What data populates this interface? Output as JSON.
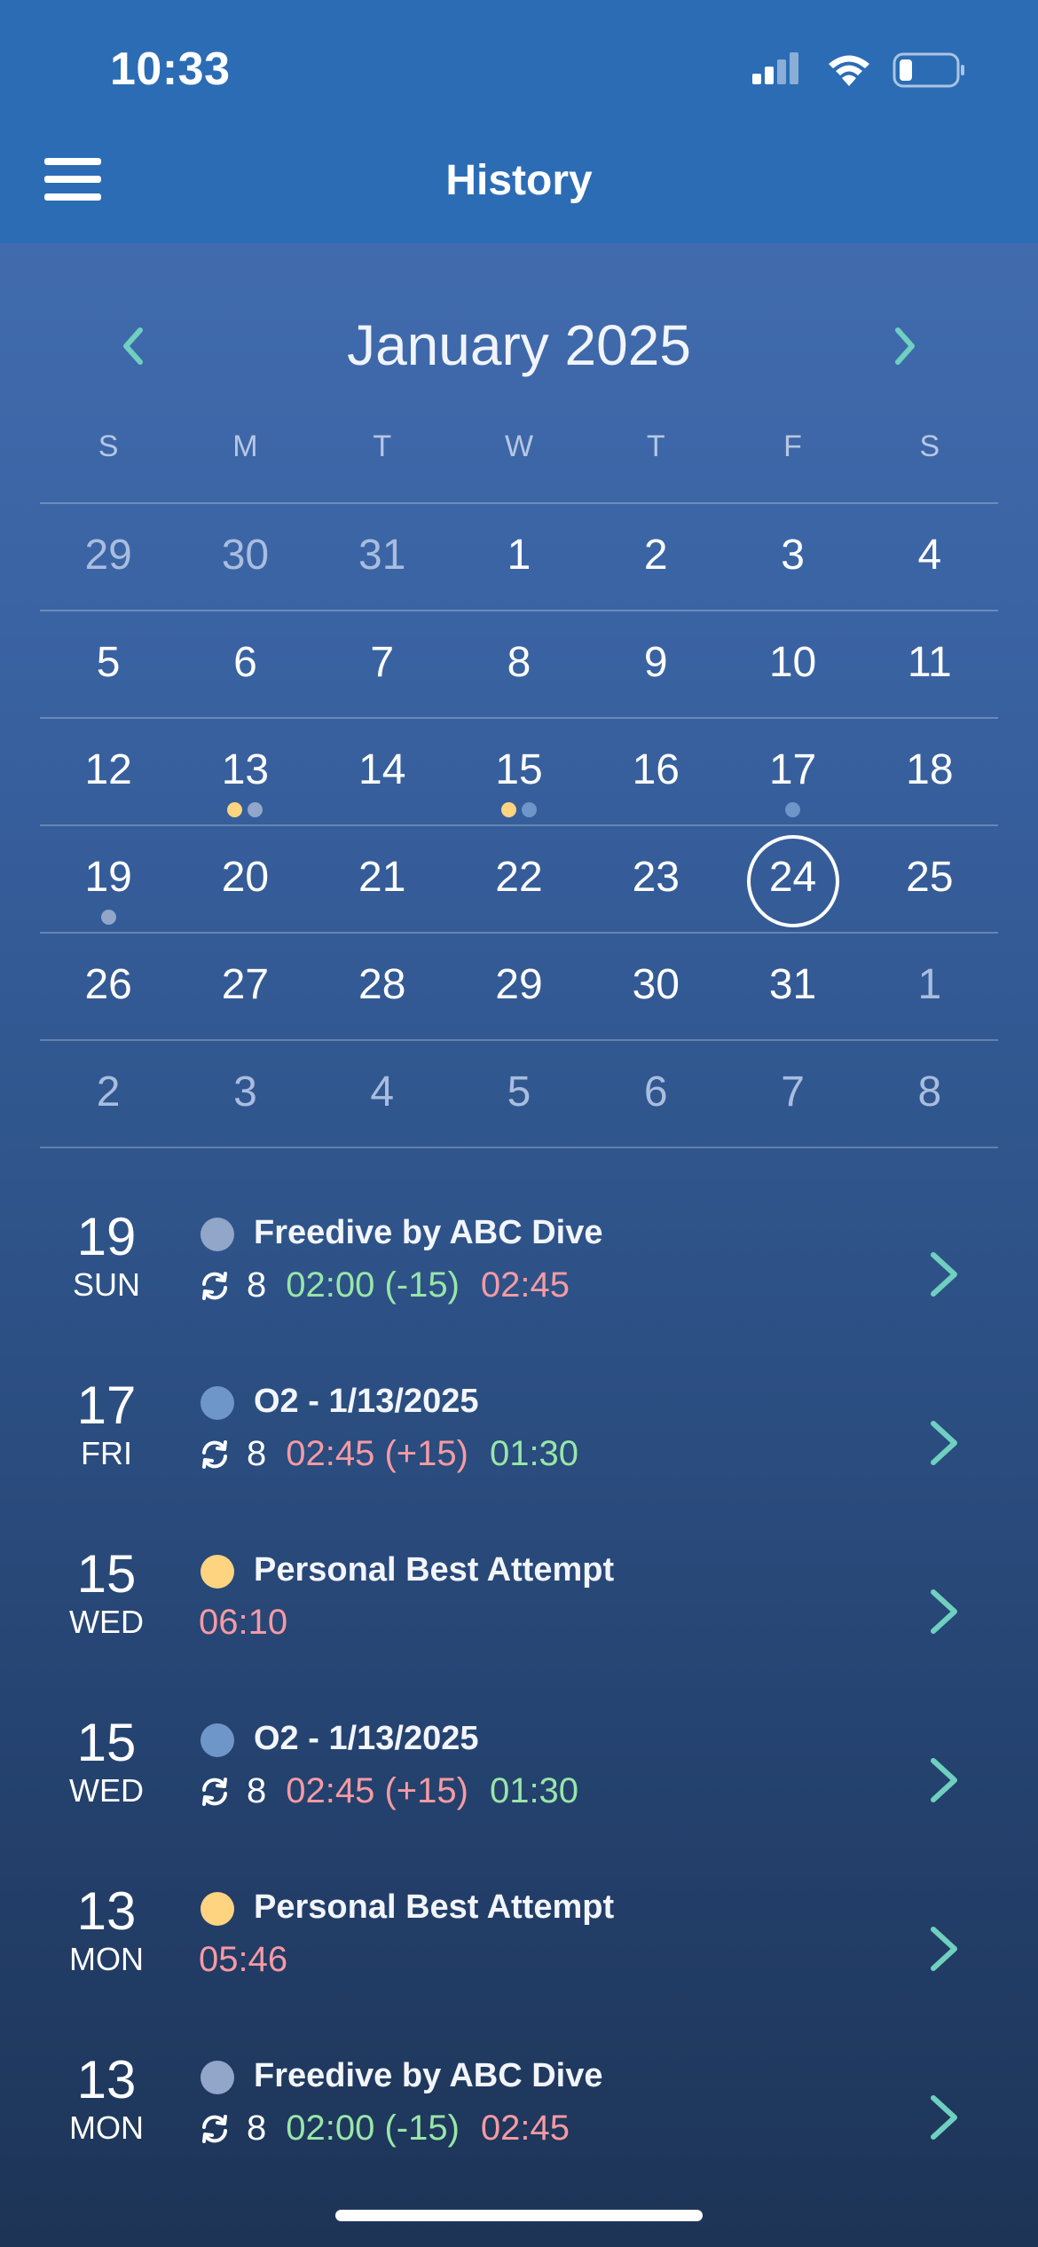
{
  "status": {
    "time": "10:33"
  },
  "header": {
    "title": "History"
  },
  "calendar": {
    "month_label": "January 2025",
    "weekdays": [
      "S",
      "M",
      "T",
      "W",
      "T",
      "F",
      "S"
    ],
    "weeks": [
      [
        "29",
        "30",
        "31",
        "1",
        "2",
        "3",
        "4"
      ],
      [
        "5",
        "6",
        "7",
        "8",
        "9",
        "10",
        "11"
      ],
      [
        "12",
        "13",
        "14",
        "15",
        "16",
        "17",
        "18"
      ],
      [
        "19",
        "20",
        "21",
        "22",
        "23",
        "24",
        "25"
      ],
      [
        "26",
        "27",
        "28",
        "29",
        "30",
        "31",
        "1"
      ],
      [
        "2",
        "3",
        "4",
        "5",
        "6",
        "7",
        "8"
      ]
    ],
    "selected_day": "24"
  },
  "colors": {
    "accent_teal": "#6fd0c0",
    "dot_yellow": "#fed480",
    "dot_blue": "#6f96c8",
    "dot_grey": "#91a6c8",
    "green_time": "#98e6a8",
    "pink_time": "#f59aa4"
  },
  "entries": [
    {
      "day": "19",
      "dow": "SUN",
      "title": "Freedive by ABC Dive",
      "dot": "grey",
      "count": "8",
      "time1": "02:00 (-15)",
      "time1_color": "green",
      "time2": "02:45",
      "time2_color": "pink"
    },
    {
      "day": "17",
      "dow": "FRI",
      "title": "O2 - 1/13/2025",
      "dot": "blue",
      "count": "8",
      "time1": "02:45 (+15)",
      "time1_color": "pink",
      "time2": "01:30",
      "time2_color": "green"
    },
    {
      "day": "15",
      "dow": "WED",
      "title": "Personal Best Attempt",
      "dot": "yellow",
      "result": "06:10"
    },
    {
      "day": "15",
      "dow": "WED",
      "title": "O2 - 1/13/2025",
      "dot": "blue",
      "count": "8",
      "time1": "02:45 (+15)",
      "time1_color": "pink",
      "time2": "01:30",
      "time2_color": "green"
    },
    {
      "day": "13",
      "dow": "MON",
      "title": "Personal Best Attempt",
      "dot": "yellow",
      "result": "05:46"
    },
    {
      "day": "13",
      "dow": "MON",
      "title": "Freedive by ABC Dive",
      "dot": "grey",
      "count": "8",
      "time1": "02:00 (-15)",
      "time1_color": "green",
      "time2": "02:45",
      "time2_color": "pink"
    }
  ]
}
